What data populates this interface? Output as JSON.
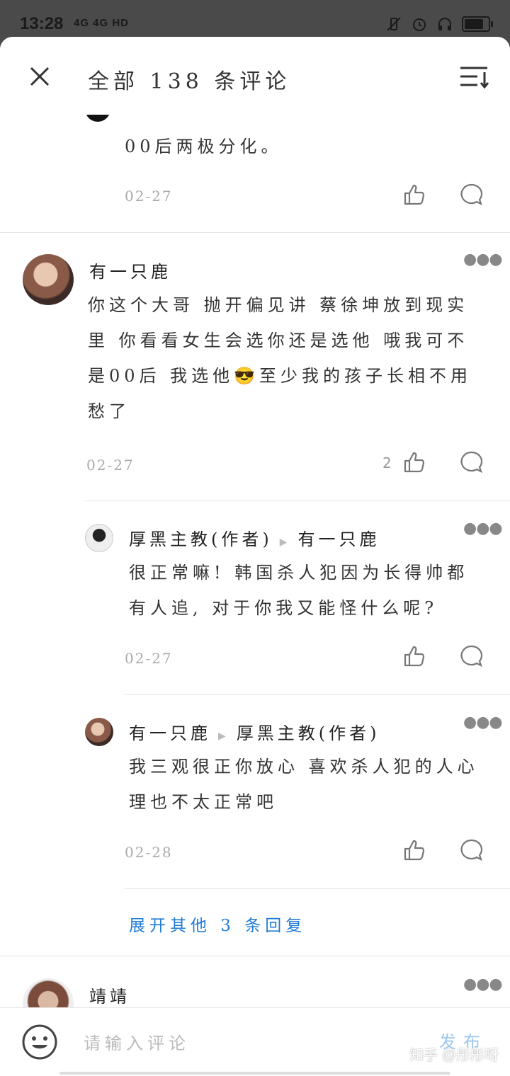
{
  "status_bar": {
    "time": "13:28",
    "network": "4G 4G HD"
  },
  "header": {
    "title": "全部 138 条评论"
  },
  "comments": [
    {
      "body": "00后两极分化。",
      "date": "02-27"
    },
    {
      "name": "有一只鹿",
      "body": "你这个大哥 抛开偏见讲 蔡徐坤放到现实里 你看看女生会选你还是选他 哦我可不是00后 我选他😎至少我的孩子长相不用愁了",
      "date": "02-27",
      "likes": "2"
    },
    {
      "name": "厚黑主教(作者)",
      "reply_to": "有一只鹿",
      "body": "很正常嘛! 韩国杀人犯因为长得帅都有人追, 对于你我又能怪什么呢?",
      "date": "02-27"
    },
    {
      "name": "有一只鹿",
      "reply_to": "厚黑主教(作者)",
      "body": "我三观很正你放心 喜欢杀人犯的人心理也不太正常吧",
      "date": "02-28"
    },
    {
      "name": "靖靖"
    }
  ],
  "expand_replies": "展开其他 3 条回复",
  "input": {
    "placeholder": "请输入评论",
    "publish_label": "发布"
  },
  "watermark": "知乎 @彤彤呀"
}
